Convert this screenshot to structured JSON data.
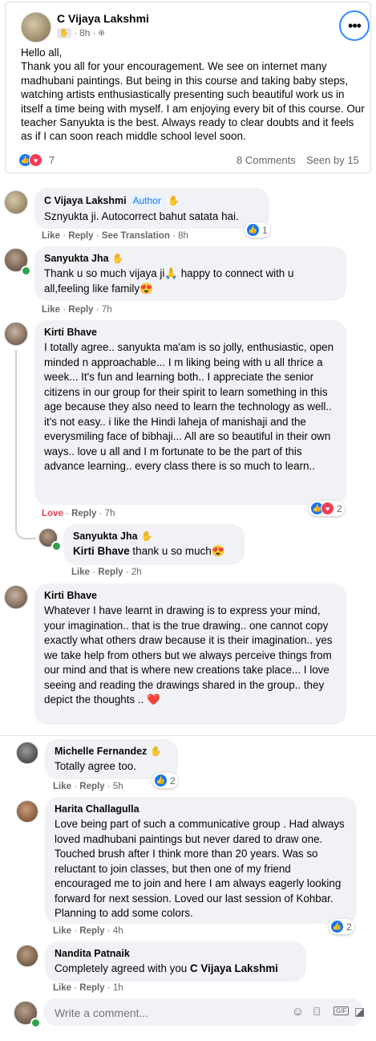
{
  "post": {
    "author": "C Vijaya Lakshmi",
    "time": "8h",
    "text": "Hello all,\nThank you all for your encouragement. We see on internet many madhubani paintings. But being in this course and taking baby steps, watching artists enthusiastically presenting such beautiful work us in itself a time being with myself. I am enjoying every bit of this course. Our teacher Sanyukta is the best. Always ready to clear doubts and it feels as if I can soon reach middle school level soon.",
    "reaction_count": "7",
    "comments_count": "8 Comments",
    "seen_by": "Seen by 15"
  },
  "labels": {
    "like": "Like",
    "love": "Love",
    "reply": "Reply",
    "see_translation": "See Translation",
    "author_badge": "Author",
    "dot": "·"
  },
  "comments": [
    {
      "name": "C Vijaya Lakshmi",
      "text": "Sznyukta ji. Autocorrect bahut satata hai.",
      "time": "8h",
      "reactions": "1"
    },
    {
      "name": "Sanyukta Jha",
      "text": "Thank u so much vijaya ji🙏 happy to connect with u all,feeling like family😍",
      "time": "7h"
    },
    {
      "name": "Kirti Bhave",
      "text": "I totally agree.. sanyukta ma'am is so jolly, enthusiastic, open minded n approachable... I m liking being with u all thrice a week... It's fun and learning both.. I appreciate the senior citizens in our group for their spirit to learn something in this age because they also need to learn the technology as well.. it's not easy.. i like the Hindi laheja of manishaji and the everysmiling face of bibhaji... All are so beautiful in their own ways.. love u all and I m fortunate to be the part of this advance learning.. every class there is so much to learn..",
      "time": "7h",
      "reactions": "2"
    },
    {
      "name": "Sanyukta Jha",
      "mention": "Kirti Bhave",
      "text": " thank u so much😍",
      "time": "2h"
    },
    {
      "name": "Kirti Bhave",
      "text": "Whatever I have learnt in drawing is to express your mind, your imagination.. that is the true drawing.. one cannot copy exactly what others draw because it is their imagination.. yes we take help from others but we always perceive things from our mind and that is where new creations take place... I love seeing and reading the drawings shared in the group.. they depict the thoughts .. ❤️"
    },
    {
      "name": "Michelle Fernandez",
      "text": "Totally agree too.",
      "time": "5h",
      "reactions": "2"
    },
    {
      "name": "Harita Challagulla",
      "text": "Love being part of such a communicative group . Had always loved madhubani paintings but never dared to draw one. Touched brush after I think more than 20 years. Was so reluctant to join classes, but then one of my friend encouraged me to join and here I am always eagerly looking forward for next session. Loved our last session of Kohbar. Planning to add some colors.",
      "time": "4h",
      "reactions": "2"
    },
    {
      "name": "Nandita Patnaik",
      "text": "Completely agreed with you ",
      "mention": "C Vijaya Lakshmi",
      "time": "1h"
    }
  ],
  "composer": {
    "placeholder": "Write a comment..."
  },
  "colors": {
    "accent": "#1877f2",
    "love": "#f33e58",
    "bubble": "#f0f2f5",
    "meta": "#65676b"
  }
}
